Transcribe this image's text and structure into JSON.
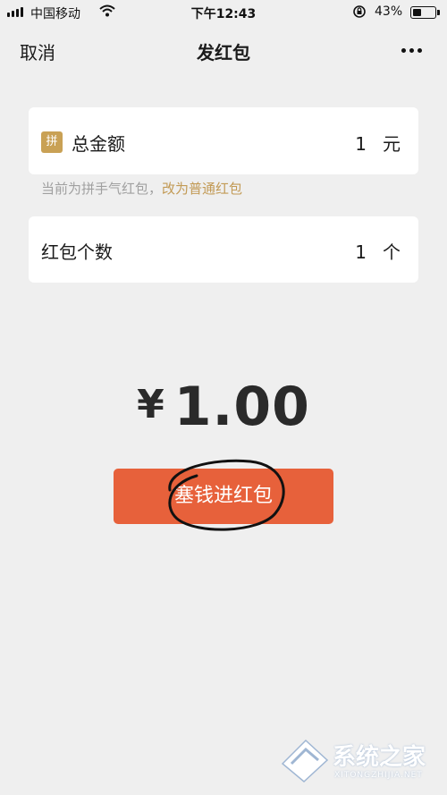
{
  "status_bar": {
    "carrier": "中国移动",
    "time": "下午12:43",
    "battery_percent": "43%",
    "battery_level": 0.43
  },
  "nav": {
    "cancel_label": "取消",
    "title": "发红包",
    "more_icon": "more-dots-icon"
  },
  "amount_field": {
    "badge": "拼",
    "label": "总金额",
    "value": "1",
    "unit": "元"
  },
  "hint": {
    "text": "当前为拼手气红包，",
    "link": "改为普通红包"
  },
  "count_field": {
    "label": "红包个数",
    "value": "1",
    "unit": "个"
  },
  "total": {
    "currency": "¥",
    "amount": "1.00"
  },
  "submit_button": {
    "label": "塞钱进红包",
    "color": "#e7613b"
  },
  "watermark": {
    "text": "系统之家",
    "sub": "XITONGZHIJIA.NET"
  },
  "colors": {
    "background": "#efefef",
    "accent_gold": "#c29a55",
    "badge_gold": "#c9a155"
  }
}
